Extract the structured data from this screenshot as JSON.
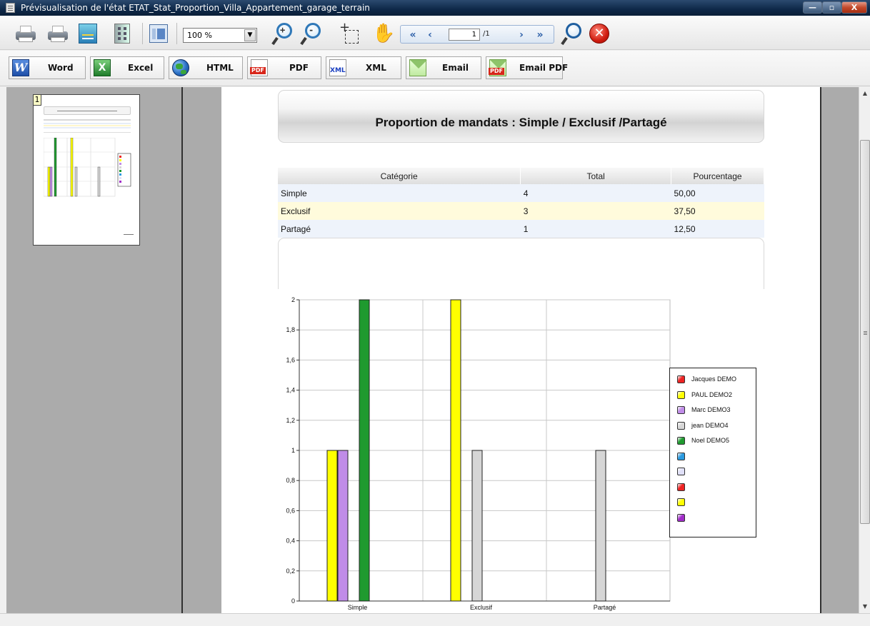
{
  "window": {
    "title": "Prévisualisation de l'état ETAT_Stat_Proportion_Villa_Appartement_garage_terrain"
  },
  "toolbar": {
    "zoom_value": "100 %",
    "page_current": "1",
    "page_total": "/1"
  },
  "export": {
    "word": "Word",
    "excel": "Excel",
    "html": "HTML",
    "pdf": "PDF",
    "xml": "XML",
    "email": "Email",
    "email_pdf": "Email PDF"
  },
  "thumbnail": {
    "page_number": "1"
  },
  "report": {
    "title": "Proportion de mandats : Simple / Exclusif /Partagé",
    "table": {
      "headers": [
        "Catégorie",
        "Total",
        "Pourcentage"
      ],
      "rows": [
        [
          "Simple",
          "4",
          "50,00"
        ],
        [
          "Exclusif",
          "3",
          "37,50"
        ],
        [
          "Partagé",
          "1",
          "12,50"
        ]
      ]
    }
  },
  "colors": {
    "window_bg": "#f0f0f0",
    "pane_gray": "#ababab",
    "page_white": "#ffffff"
  },
  "chart_data": {
    "type": "bar",
    "categories": [
      "Simple",
      "Exclusif",
      "Partagé"
    ],
    "ylim": [
      0,
      2
    ],
    "yticks": [
      "0",
      "0,2",
      "0,4",
      "0,6",
      "0,8",
      "1",
      "1,2",
      "1,4",
      "1,6",
      "1,8",
      "2"
    ],
    "grid": true,
    "legend_position": "right",
    "series": [
      {
        "name": "Jacques DEMO",
        "color": "#ee2222",
        "values": [
          0,
          0,
          0
        ]
      },
      {
        "name": "PAUL DEMO2",
        "color": "#ffff00",
        "values": [
          1,
          2,
          0
        ]
      },
      {
        "name": "Marc DEMO3",
        "color": "#c08ce8",
        "values": [
          1,
          0,
          0
        ]
      },
      {
        "name": "jean DEMO4",
        "color": "#d6d6d6",
        "values": [
          0,
          1,
          1
        ]
      },
      {
        "name": "Noel DEMO5",
        "color": "#1f9a2f",
        "values": [
          2,
          0,
          0
        ]
      }
    ],
    "extra_legend_colors": [
      "#2a9ae0",
      "#e0e0f8",
      "#ee2222",
      "#ffff00",
      "#a02cc8"
    ]
  }
}
